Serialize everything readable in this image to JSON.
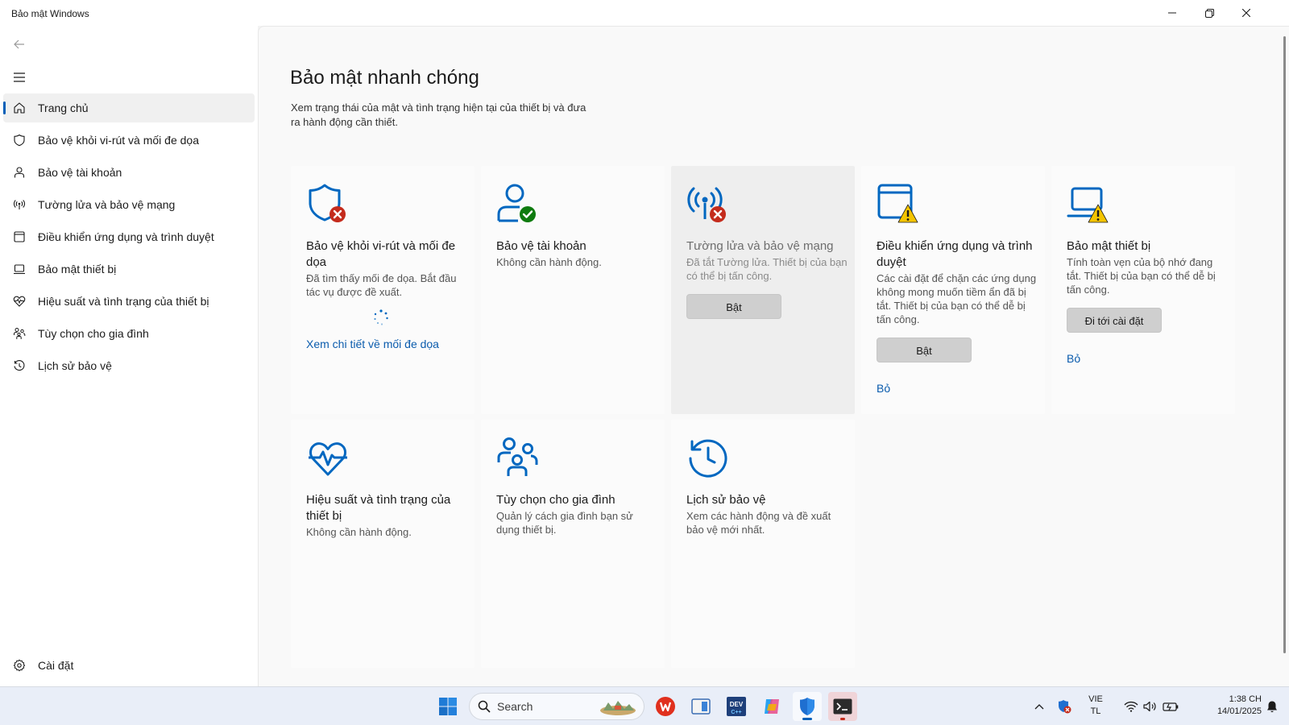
{
  "window": {
    "title": "Bảo mật Windows"
  },
  "sidebar": {
    "items": [
      {
        "label": "Trang chủ",
        "icon": "home-icon",
        "active": true
      },
      {
        "label": "Bảo vệ khỏi vi-rút và mối đe dọa",
        "icon": "shield-icon"
      },
      {
        "label": "Bảo vệ tài khoản",
        "icon": "person-icon"
      },
      {
        "label": "Tường lửa và bảo vệ mạng",
        "icon": "antenna-icon"
      },
      {
        "label": "Điều khiển ứng dụng và trình duyệt",
        "icon": "browser-window-icon"
      },
      {
        "label": "Bảo mật thiết bị",
        "icon": "laptop-icon"
      },
      {
        "label": "Hiệu suất và tình trạng của thiết bị",
        "icon": "heart-pulse-icon"
      },
      {
        "label": "Tùy chọn cho gia đình",
        "icon": "family-icon"
      },
      {
        "label": "Lịch sử bảo vệ",
        "icon": "history-icon"
      }
    ],
    "settings_label": "Cài đặt"
  },
  "main": {
    "title": "Bảo mật nhanh chóng",
    "description": "Xem trạng thái của mật và tình trạng hiện tại của thiết bị và đưa ra hành động cần thiết.",
    "tiles": [
      {
        "title": "Bảo vệ khỏi vi-rút và mối đe dọa",
        "desc": "Đã tìm thấy mối đe dọa. Bắt đầu tác vụ được đề xuất.",
        "link": "Xem chi tiết về mối đe dọa",
        "status": "error"
      },
      {
        "title": "Bảo vệ tài khoản",
        "desc": "Không cần hành động.",
        "status": "ok"
      },
      {
        "title": "Tường lửa và bảo vệ mạng",
        "desc": "Đã tắt Tường lửa. Thiết bị của bạn có thể bị tấn công.",
        "button": "Bật",
        "status": "error"
      },
      {
        "title": "Điều khiển ứng dụng và trình duyệt",
        "desc": "Các cài đặt để chặn các ứng dụng không mong muốn tiềm ẩn đã bị tắt. Thiết bị của bạn có thể dễ bị tấn công.",
        "button": "Bật",
        "link": "Bỏ",
        "status": "warning"
      },
      {
        "title": "Bảo mật thiết bị",
        "desc": "Tính toàn vẹn của bộ nhớ đang tắt. Thiết bị của bạn có thể dễ bị tấn công.",
        "button": "Đi tới cài đặt",
        "link": "Bỏ",
        "status": "warning"
      },
      {
        "title": "Hiệu suất và tình trạng của thiết bị",
        "desc": "Không cần hành động."
      },
      {
        "title": "Tùy chọn cho gia đình",
        "desc": "Quản lý cách gia đình bạn sử dụng thiết bị."
      },
      {
        "title": "Lịch sử bảo vệ",
        "desc": "Xem các hành động và đề xuất bảo vệ mới nhất."
      }
    ]
  },
  "taskbar": {
    "search_placeholder": "Search",
    "language": "VIE",
    "input_mode": "TL",
    "time": "1:38 CH",
    "date": "14/01/2025"
  },
  "colors": {
    "accent": "#005fb8",
    "icon_blue": "#0067c0",
    "error_red": "#c42b1c",
    "ok_green": "#0f7b0f",
    "warning_yellow": "#f4c400"
  }
}
